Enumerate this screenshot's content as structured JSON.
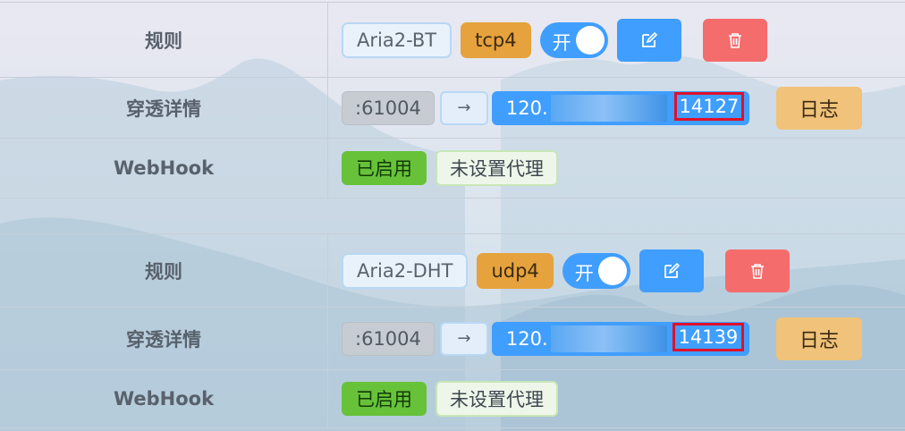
{
  "colors": {
    "primary": "#409eff",
    "warning": "#e6a23c",
    "danger": "#f56c6c",
    "success": "#67c23a",
    "highlight_box": "#e0102a"
  },
  "rules": [
    {
      "rule_label": "规则",
      "name": "Aria2-BT",
      "protocol": "tcp4",
      "switch_text": "开",
      "edit_icon": "edit-icon",
      "delete_icon": "trash-icon",
      "detail_label": "穿透详情",
      "local_port": ":61004",
      "arrow": "→",
      "remote_prefix": "120.",
      "remote_port": "14127",
      "log_button": "日志",
      "webhook_label": "WebHook",
      "webhook_status": "已启用",
      "proxy_status": "未设置代理"
    },
    {
      "rule_label": "规则",
      "name": "Aria2-DHT",
      "protocol": "udp4",
      "switch_text": "开",
      "edit_icon": "edit-icon",
      "delete_icon": "trash-icon",
      "detail_label": "穿透详情",
      "local_port": ":61004",
      "arrow": "→",
      "remote_prefix": "120.",
      "remote_port": "14139",
      "log_button": "日志",
      "webhook_label": "WebHook",
      "webhook_status": "已启用",
      "proxy_status": "未设置代理"
    }
  ]
}
